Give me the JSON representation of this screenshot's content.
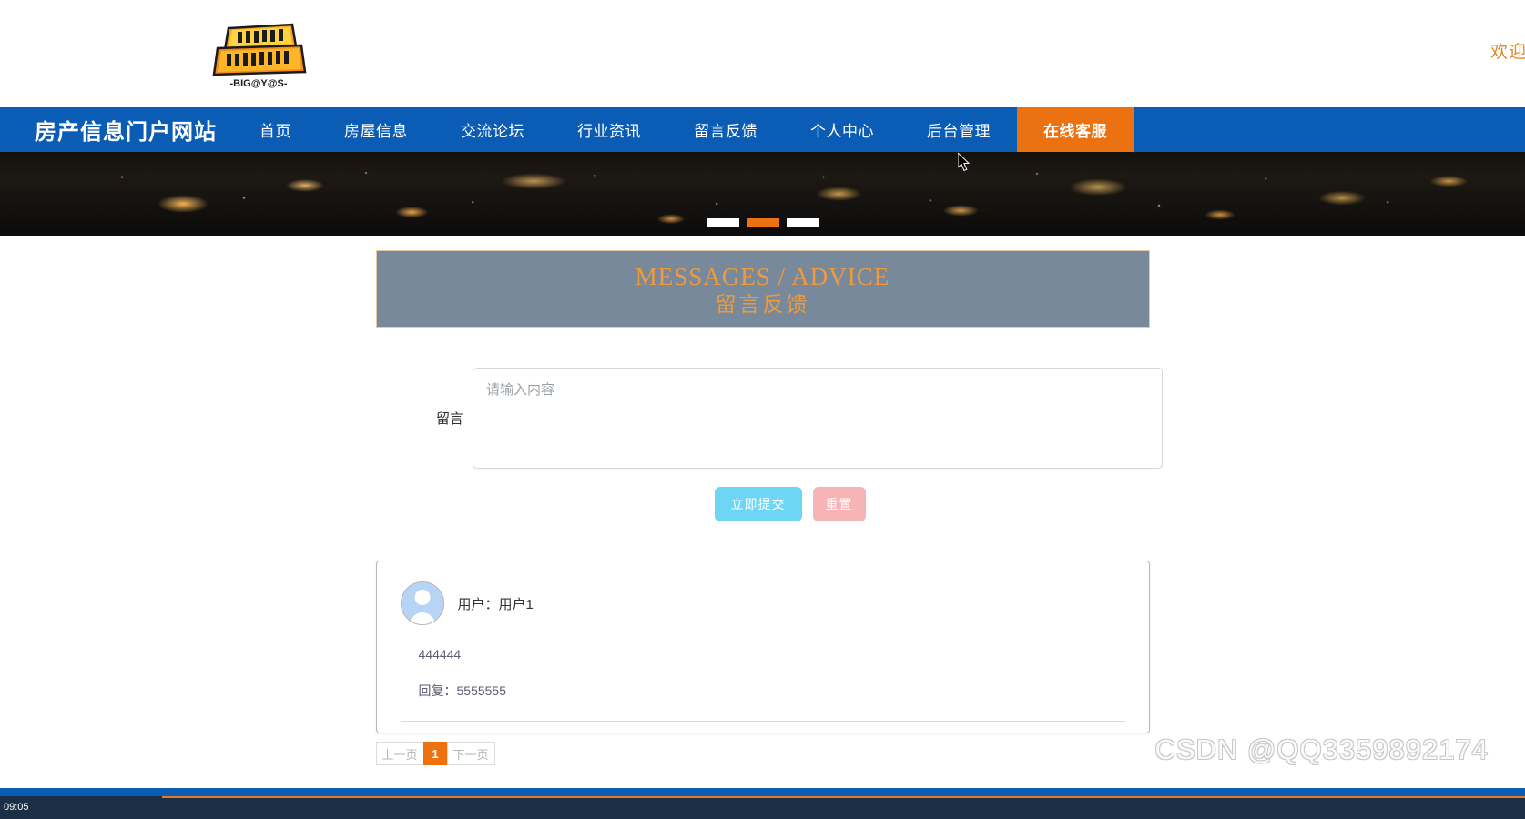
{
  "header": {
    "logo_alt": "digimon-adventure-logo",
    "logo_subtitle": "-BIG@Y@S-",
    "welcome_text": "欢迎来"
  },
  "nav": {
    "brand": "房产信息门户网站",
    "items": [
      {
        "label": "首页",
        "active": false
      },
      {
        "label": "房屋信息",
        "active": false
      },
      {
        "label": "交流论坛",
        "active": false
      },
      {
        "label": "行业资讯",
        "active": false
      },
      {
        "label": "留言反馈",
        "active": false
      },
      {
        "label": "个人中心",
        "active": false
      },
      {
        "label": "后台管理",
        "active": false
      },
      {
        "label": "在线客服",
        "active": true
      }
    ]
  },
  "banner": {
    "alt": "city-night-skyline",
    "carousel": {
      "total": 3,
      "active_index": 1
    }
  },
  "section": {
    "title_en": "MESSAGES / ADVICE",
    "title_cn": "留言反馈",
    "accent_color": "#ef9a3c",
    "background_color": "#78899c"
  },
  "form": {
    "message_label": "留言",
    "message_value": "",
    "message_placeholder": "请输入内容",
    "submit_label": "立即提交",
    "reset_label": "重置",
    "submit_color": "#6ed6f5",
    "reset_color": "#f7b4b4"
  },
  "comments": [
    {
      "user_line": "用户：用户1",
      "content": "444444",
      "reply": "回复：5555555"
    }
  ],
  "pagination": {
    "prev_label": "上一页",
    "next_label": "下一页",
    "pages": [
      "1"
    ],
    "current_page": "1",
    "active_color": "#ec7211"
  },
  "watermark": {
    "text": "CSDN @QQ3359892174"
  },
  "taskbar": {
    "clock": "09:05"
  }
}
